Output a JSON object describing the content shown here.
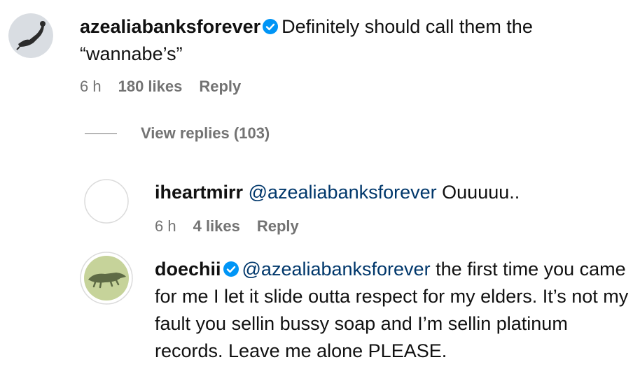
{
  "comments": [
    {
      "username": "azealiabanksforever",
      "verified": true,
      "mention": "",
      "text": "Definitely should call them the “wannabe’s”",
      "time": "6 h",
      "likes": "180 likes",
      "reply": "Reply",
      "avatar_icon": "profile-photo-icon"
    },
    {
      "username": "iheartmirr",
      "verified": false,
      "mention": "@azealiabanksforever",
      "text": "Ouuuuu..",
      "time": "6 h",
      "likes": "4 likes",
      "reply": "Reply",
      "avatar_icon": "empty-avatar-icon"
    },
    {
      "username": "doechii",
      "verified": true,
      "mention": "@azealiabanksforever",
      "text": "the first time you came for me I let it slide outta respect for my elders. It’s not my fault you sellin bussy soap and I’m sellin platinum records. Leave me alone PLEASE.",
      "avatar_icon": "alligator-avatar-icon"
    }
  ],
  "view_replies": "View replies (103)",
  "colors": {
    "verified": "#0095f6",
    "mention": "#00376b",
    "meta": "#737373"
  }
}
